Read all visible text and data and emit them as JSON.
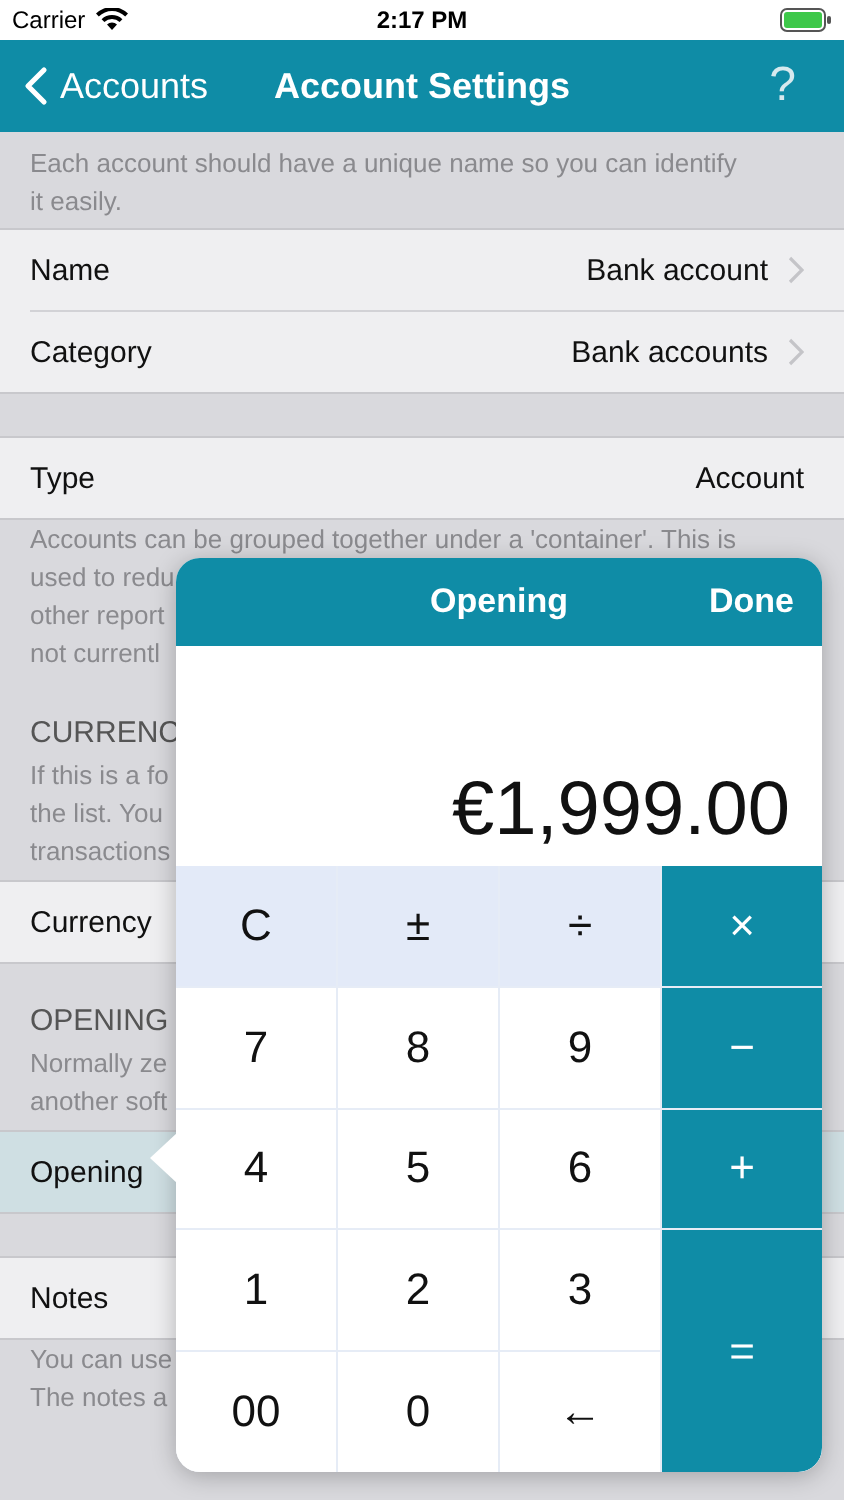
{
  "status_bar": {
    "carrier": "Carrier",
    "time": "2:17 PM"
  },
  "nav": {
    "back": "Accounts",
    "title": "Account Settings",
    "help": "?"
  },
  "sections": [
    {
      "footer_lines": [
        "Each account should have a unique name so you can identify",
        "it easily."
      ]
    },
    {
      "rows": [
        {
          "label": "Name",
          "value": "Bank account",
          "chevron": true,
          "selected": false
        },
        {
          "label": "Category",
          "value": "Bank accounts",
          "chevron": true,
          "selected": false
        }
      ]
    },
    {
      "rows": [
        {
          "label": "Type",
          "value": "Account",
          "chevron": false,
          "selected": false
        }
      ],
      "footer_lines": [
        "Accounts can be grouped together under a 'container'. This is",
        "used to redu",
        "other report",
        "not currentl"
      ]
    },
    {
      "header": "CURRENC",
      "note_lines": [
        "If this is a fo",
        "the list. You",
        "transactions"
      ],
      "rows": [
        {
          "label": "Currency",
          "chevron": false,
          "selected": false
        }
      ]
    },
    {
      "header": "OPENING",
      "note_lines": [
        "Normally ze",
        "another soft"
      ],
      "rows": [
        {
          "label": "Opening",
          "chevron": false,
          "selected": true
        }
      ]
    },
    {
      "rows": [
        {
          "label": "Notes",
          "chevron": false,
          "selected": false
        }
      ],
      "footer_lines": [
        "You can use",
        "The notes a"
      ]
    }
  ],
  "calculator": {
    "title": "Opening",
    "done": "Done",
    "display": "€1,999.00",
    "keys": [
      {
        "label": "C",
        "kind": "function"
      },
      {
        "label": "±",
        "kind": "function"
      },
      {
        "label": "÷",
        "kind": "function"
      },
      {
        "label": "×",
        "kind": "operator"
      },
      {
        "label": "7",
        "kind": "digit"
      },
      {
        "label": "8",
        "kind": "digit"
      },
      {
        "label": "9",
        "kind": "digit"
      },
      {
        "label": "−",
        "kind": "operator"
      },
      {
        "label": "4",
        "kind": "digit"
      },
      {
        "label": "5",
        "kind": "digit"
      },
      {
        "label": "6",
        "kind": "digit"
      },
      {
        "label": "+",
        "kind": "operator"
      },
      {
        "label": "1",
        "kind": "digit"
      },
      {
        "label": "2",
        "kind": "digit"
      },
      {
        "label": "3",
        "kind": "digit"
      },
      {
        "label": "=",
        "kind": "operator",
        "tall": true
      },
      {
        "label": "00",
        "kind": "digit"
      },
      {
        "label": "0",
        "kind": "digit"
      },
      {
        "label": "←",
        "kind": "digit"
      }
    ]
  }
}
